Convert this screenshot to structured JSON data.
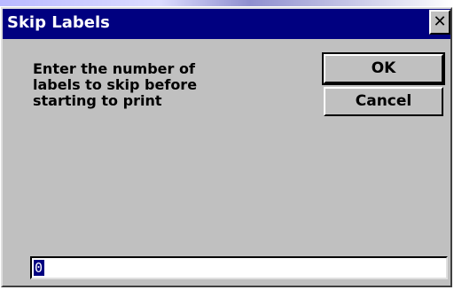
{
  "dialog": {
    "title": "Skip Labels",
    "close_glyph": "✕",
    "prompt_text": "Enter the number of\nlabels to skip before\nstarting to print",
    "ok_label": "OK",
    "cancel_label": "Cancel",
    "input_value": "0"
  },
  "colors": {
    "title_bar": "#000080",
    "dialog_face": "#c0c0c0",
    "selection": "#000080"
  },
  "icons": {
    "close": "close-icon"
  }
}
